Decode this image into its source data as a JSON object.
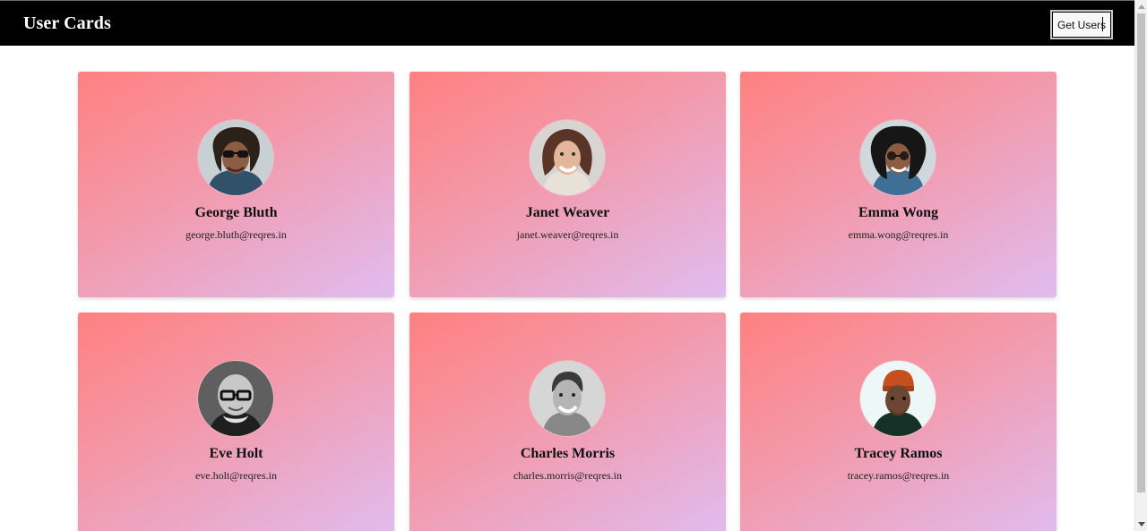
{
  "header": {
    "title": "User Cards",
    "get_users_label": "Get Users"
  },
  "cards": [
    {
      "name": "George Bluth",
      "email": "george.bluth@reqres.in"
    },
    {
      "name": "Janet Weaver",
      "email": "janet.weaver@reqres.in"
    },
    {
      "name": "Emma Wong",
      "email": "emma.wong@reqres.in"
    },
    {
      "name": "Eve Holt",
      "email": "eve.holt@reqres.in"
    },
    {
      "name": "Charles Morris",
      "email": "charles.morris@reqres.in"
    },
    {
      "name": "Tracey Ramos",
      "email": "tracey.ramos@reqres.in"
    }
  ],
  "colors": {
    "header_bg": "#000000",
    "card_gradient_start": "#ff8080",
    "card_gradient_end": "#e0bcf0"
  }
}
